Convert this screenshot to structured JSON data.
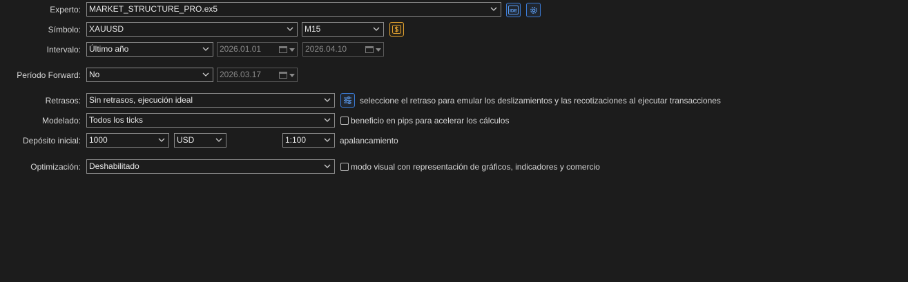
{
  "labels": {
    "experto": "Experto:",
    "simbolo": "Símbolo:",
    "intervalo": "Intervalo:",
    "periodo_forward": "Período Forward:",
    "retrasos": "Retrasos:",
    "modelado": "Modelado:",
    "deposito": "Depósito inicial:",
    "optimizacion": "Optimización:"
  },
  "experto": {
    "value": "MARKET_STRUCTURE_PRO.ex5",
    "ide_icon_text": "IDE"
  },
  "simbolo": {
    "symbol": "XAUUSD",
    "timeframe": "M15"
  },
  "intervalo": {
    "value": "Último año",
    "from_date": "2026.01.01",
    "to_date": "2026.04.10"
  },
  "periodo_forward": {
    "value": "No",
    "date": "2026.03.17"
  },
  "retrasos": {
    "value": "Sin retrasos, ejecución ideal",
    "hint": "seleccione el retraso para emular los deslizamientos y las recotizaciones al ejecutar transacciones"
  },
  "modelado": {
    "value": "Todos los ticks",
    "checkbox_label": "beneficio en pips para acelerar los cálculos",
    "checkbox_checked": false
  },
  "deposito": {
    "amount": "1000",
    "currency": "USD",
    "leverage": "1:100",
    "leverage_label": "apalancamiento"
  },
  "optimizacion": {
    "value": "Deshabilitado",
    "checkbox_label": "modo visual con representación de gráficos, indicadores y comercio",
    "checkbox_checked": false
  },
  "colors": {
    "background": "#1c1c1c",
    "accent_blue": "#3b7bd6",
    "accent_orange": "#e0a030"
  },
  "icons": [
    "chevron-down-icon",
    "ide-icon",
    "settings-gear-icon",
    "dollar-icon",
    "calendar-icon",
    "sliders-icon"
  ]
}
